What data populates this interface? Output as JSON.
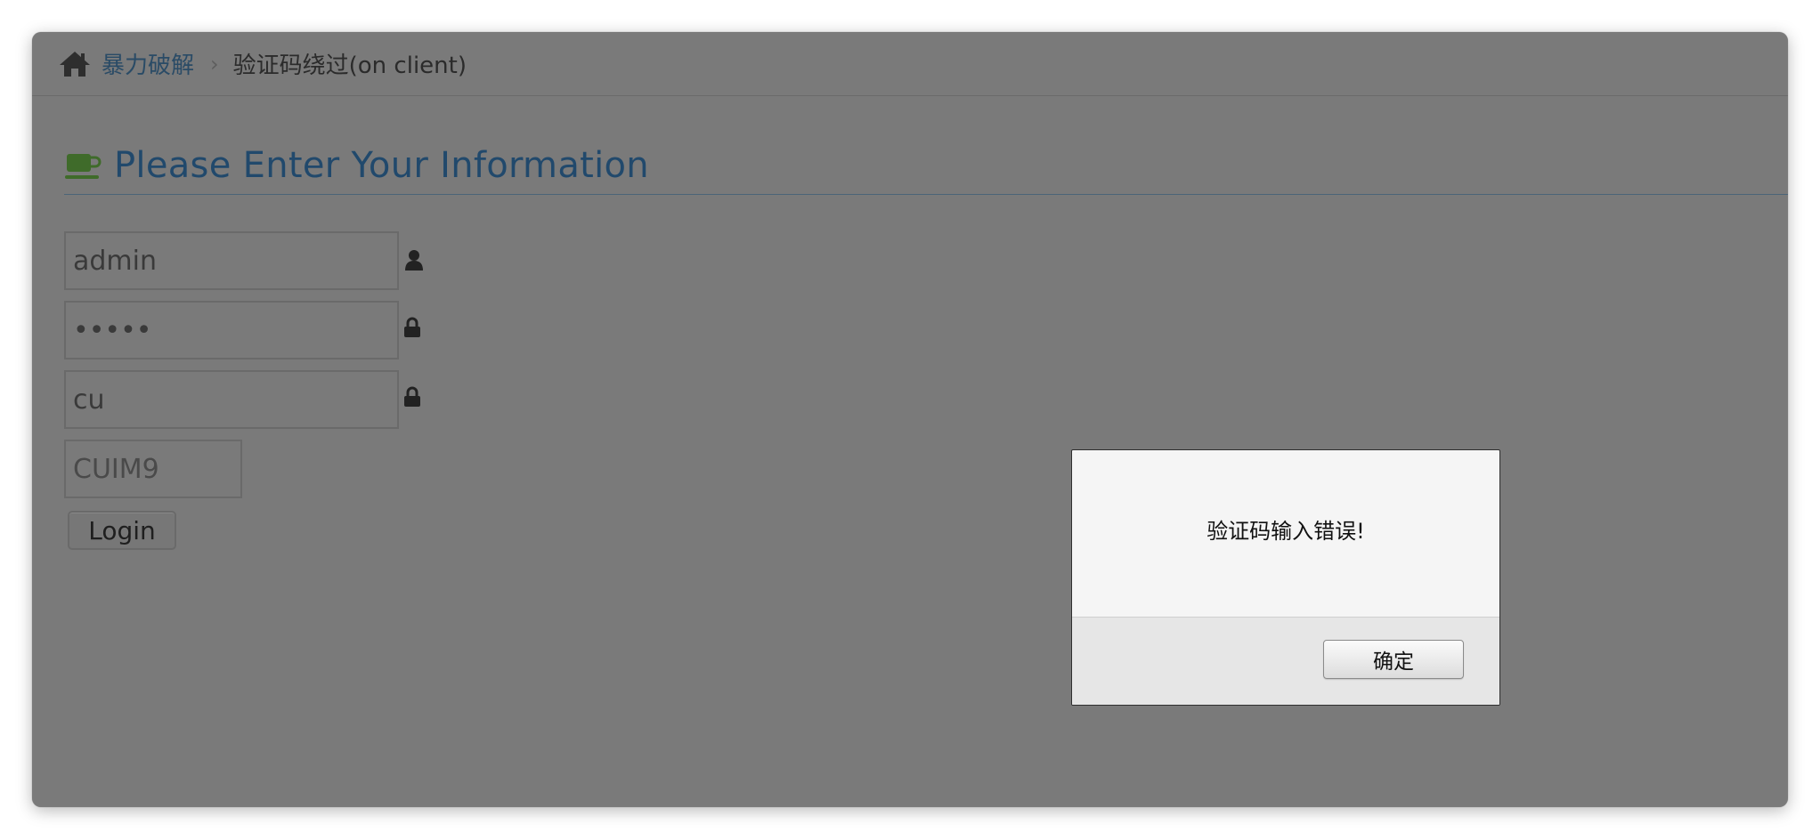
{
  "breadcrumb": {
    "home_icon": "home-icon",
    "parent_label": "暴力破解",
    "separator": "›",
    "current_label": "验证码绕过(on client)"
  },
  "heading": {
    "icon": "coffee-cup-icon",
    "title": "Please Enter Your Information"
  },
  "form": {
    "username_value": "admin",
    "username_icon": "user-icon",
    "password_value": "•••••",
    "password_icon": "lock-icon",
    "captcha_value": "cu",
    "captcha_icon": "lock-icon",
    "captcha_code": "CUIM9",
    "login_label": "Login"
  },
  "alert": {
    "message": "验证码输入错误!",
    "ok_label": "确定"
  },
  "colors": {
    "overlay": "#7a7a7a",
    "link": "#2a4b66",
    "heading": "#21496c",
    "coffee_icon": "#3f6b2a"
  }
}
